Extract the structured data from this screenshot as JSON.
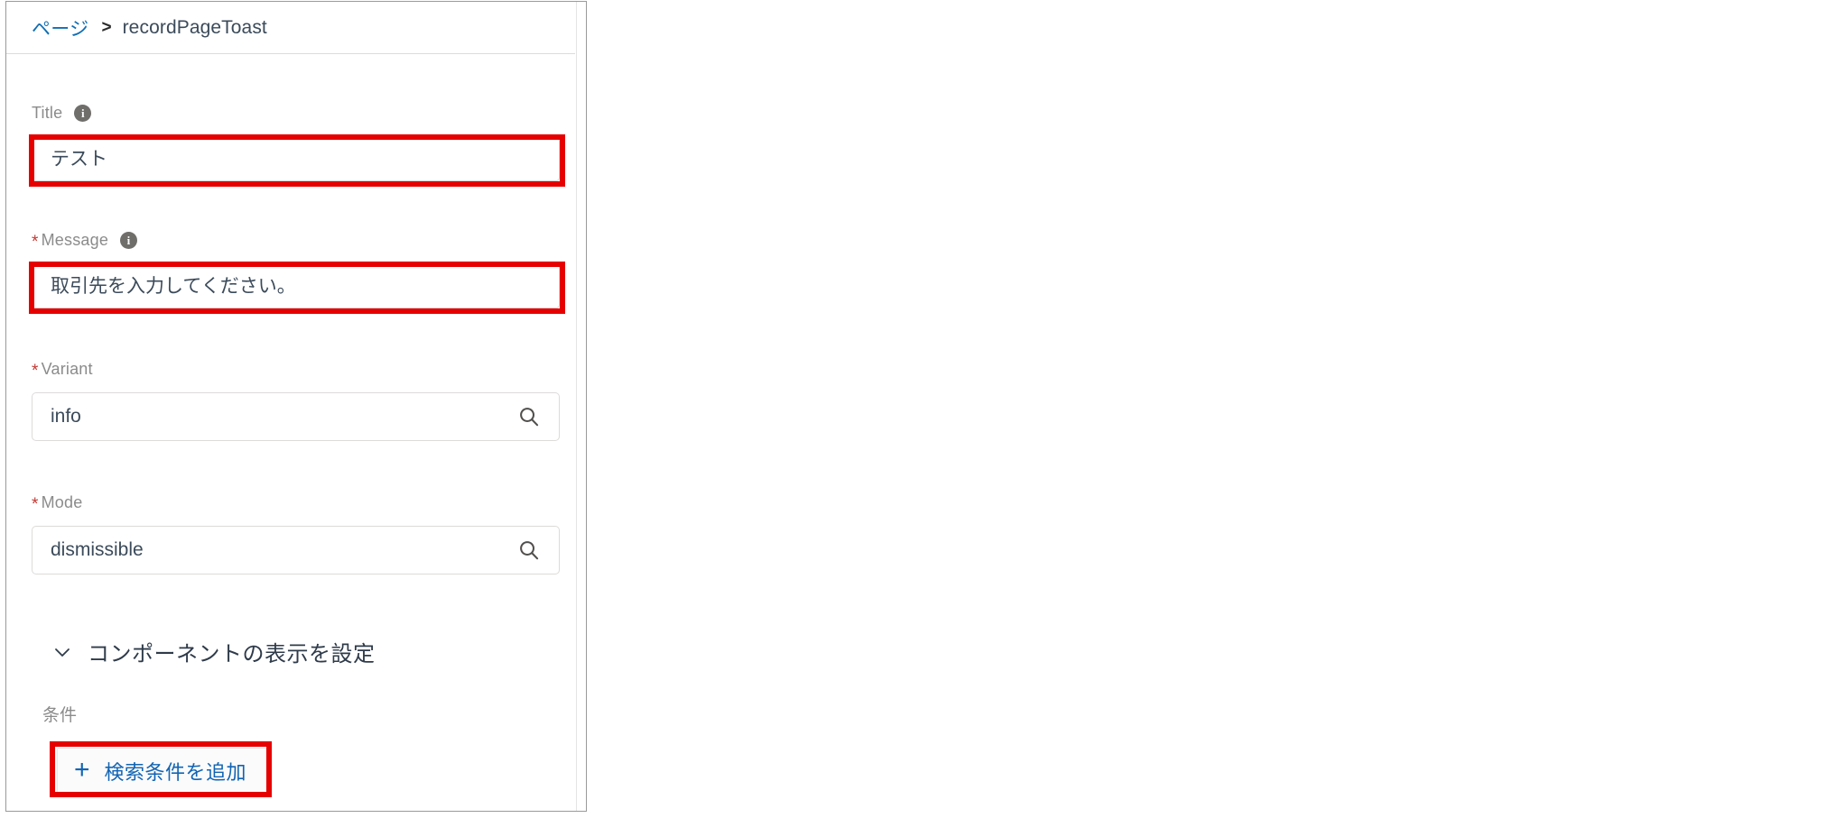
{
  "panel": {
    "breadcrumb": {
      "root_label": "ページ",
      "separator": ">",
      "current_label": "recordPageToast"
    },
    "fields": [
      {
        "label": "Title",
        "required": false,
        "has_info_icon": true,
        "value": "テスト",
        "type": "text",
        "highlighted": true
      },
      {
        "label": "Message",
        "required": true,
        "has_info_icon": true,
        "value": "取引先を入力してください。",
        "type": "text",
        "highlighted": true
      },
      {
        "label": "Variant",
        "required": true,
        "has_info_icon": false,
        "value": "info",
        "type": "combobox",
        "highlighted": false
      },
      {
        "label": "Mode",
        "required": true,
        "has_info_icon": false,
        "value": "dismissible",
        "type": "combobox",
        "highlighted": false
      }
    ],
    "section": {
      "title": "コンポーネントの表示を設定",
      "expanded": true,
      "chevron_icon": "chevron-down-icon",
      "filters_label": "条件",
      "add_filter_label": "検索条件を追加",
      "add_filter_icon": "plus-icon",
      "add_filter_highlighted": true
    },
    "icons": {
      "info": "info-icon",
      "search": "search-icon",
      "required_marker": "*"
    },
    "colors": {
      "link": "#0f6db5",
      "required_star": "#c23934",
      "label_gray": "#8b8b8b",
      "value_text": "#3b4a5a",
      "annotation_red": "#e60000",
      "panel_border": "#9a9a9a",
      "input_border": "#dddbda",
      "info_icon_bg": "#706e6b",
      "section_title": "#2f3b4a"
    }
  }
}
